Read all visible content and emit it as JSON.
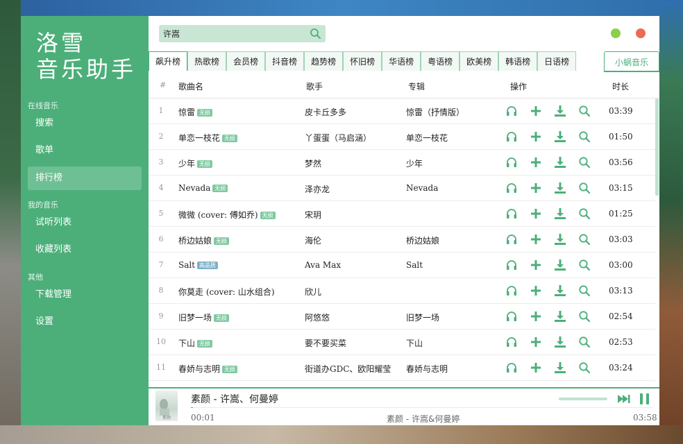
{
  "colors": {
    "accent": "#4caf7a",
    "sidebar_bg": "#4caf7a",
    "badge": "#7fc9a0",
    "close": "#ee6a55",
    "minimize": "#8ccf4a"
  },
  "app": {
    "logo_line1": "洛雪",
    "logo_line2": "音乐助手"
  },
  "sidebar": {
    "online_title": "在线音乐",
    "online_items": [
      "搜索",
      "歌单",
      "排行榜"
    ],
    "active_item": "排行榜",
    "my_title": "我的音乐",
    "my_items": [
      "试听列表",
      "收藏列表"
    ],
    "other_title": "其他",
    "other_items": [
      "下载管理",
      "设置"
    ]
  },
  "search": {
    "value": "许嵩",
    "icon": "search-icon"
  },
  "tabs": [
    "飙升榜",
    "热歌榜",
    "会员榜",
    "抖音榜",
    "趋势榜",
    "怀旧榜",
    "华语榜",
    "粤语榜",
    "欧美榜",
    "韩语榜",
    "日语榜"
  ],
  "active_tab": "飙升榜",
  "source_tab": "小蜗音乐",
  "table": {
    "headers": {
      "num": "#",
      "name": "歌曲名",
      "singer": "歌手",
      "album": "专辑",
      "ops": "操作",
      "duration": "时长"
    },
    "rows": [
      {
        "num": "1",
        "name": "惊雷",
        "badge": "无损",
        "singer": "皮卡丘多多",
        "album": "惊雷（抒情版）",
        "duration": "03:39"
      },
      {
        "num": "2",
        "name": "单恋一枝花",
        "badge": "无损",
        "singer": "丫蛋蛋（马启涵）",
        "album": "单恋一枝花",
        "duration": "01:50"
      },
      {
        "num": "3",
        "name": "少年",
        "badge": "无损",
        "singer": "梦然",
        "album": "少年",
        "duration": "03:56"
      },
      {
        "num": "4",
        "name": "Nevada",
        "badge": "无损",
        "singer": "泽亦龙",
        "album": "Nevada",
        "duration": "03:15"
      },
      {
        "num": "5",
        "name": "微微 (cover: 傅如乔)",
        "badge": "无损",
        "singer": "宋玥",
        "album": "",
        "duration": "01:25"
      },
      {
        "num": "6",
        "name": "桥边姑娘",
        "badge": "无损",
        "singer": "海伦",
        "album": "桥边姑娘",
        "duration": "03:03"
      },
      {
        "num": "7",
        "name": "Salt",
        "badge": "高品质",
        "singer": "Ava Max",
        "album": "Salt",
        "duration": "03:00"
      },
      {
        "num": "8",
        "name": "你莫走 (cover: 山水组合)",
        "badge": "",
        "singer": "欣儿",
        "album": "",
        "duration": "03:13"
      },
      {
        "num": "9",
        "name": "旧梦一场",
        "badge": "无损",
        "singer": "阿悠悠",
        "album": "旧梦一场",
        "duration": "02:54"
      },
      {
        "num": "10",
        "name": "下山",
        "badge": "无损",
        "singer": "要不要买菜",
        "album": "下山",
        "duration": "02:53"
      },
      {
        "num": "11",
        "name": "春娇与志明",
        "badge": "无损",
        "singer": "街道办GDC、欧阳耀莹",
        "album": "春娇与志明",
        "duration": "03:24"
      }
    ]
  },
  "player": {
    "title": "素颜 - 许嵩、何曼婷",
    "cover_caption": "素颜",
    "current_time": "00:01",
    "now_playing": "素颜 - 许嵩&何曼婷",
    "total_time": "03:58",
    "progress": 0.005
  }
}
